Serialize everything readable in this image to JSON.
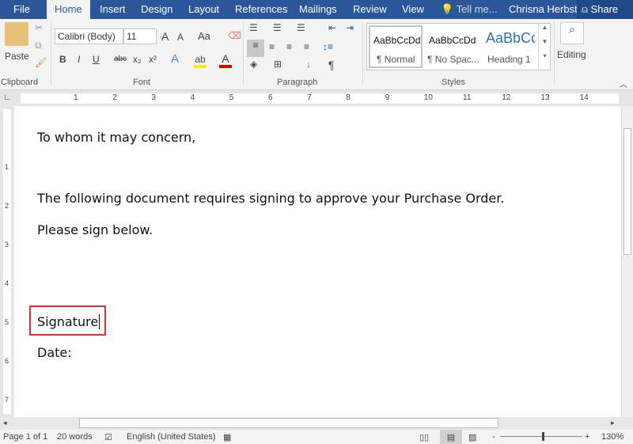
{
  "tabs": [
    {
      "label": "File"
    },
    {
      "label": "Home"
    },
    {
      "label": "Insert"
    },
    {
      "label": "Design"
    },
    {
      "label": "Layout"
    },
    {
      "label": "References"
    },
    {
      "label": "Mailings"
    },
    {
      "label": "Review"
    },
    {
      "label": "View"
    }
  ],
  "tell_me": "Tell me...",
  "user": "Chrisna Herbst",
  "share": "Share",
  "clipboard": {
    "paste": "Paste",
    "label": "Clipboard"
  },
  "font": {
    "name": "Calibri (Body)",
    "size": "11",
    "grow": "A",
    "shrink": "A",
    "case": "Aa",
    "bold": "B",
    "italic": "I",
    "underline": "U",
    "strike": "abc",
    "sub": "x₂",
    "sup": "x²",
    "effects": "A",
    "color": "A",
    "label": "Font"
  },
  "paragraph": {
    "label": "Paragraph",
    "pilcrow": "¶"
  },
  "styles": {
    "label": "Styles",
    "items": [
      {
        "preview": "AaBbCcDd",
        "name": "¶ Normal"
      },
      {
        "preview": "AaBbCcDd",
        "name": "¶ No Spac..."
      },
      {
        "preview": "AaBbCc",
        "name": "Heading 1"
      }
    ]
  },
  "editing": {
    "label": "Editing"
  },
  "ruler": [
    "1",
    "2",
    "3",
    "4",
    "5",
    "6",
    "7",
    "8",
    "9",
    "10",
    "11",
    "12",
    "13",
    "14"
  ],
  "vruler": [
    "1",
    "2",
    "3",
    "4",
    "5",
    "6",
    "7"
  ],
  "document": {
    "lines": [
      "To whom it may concern,",
      "The following document requires signing to approve your Purchase Order.",
      "Please sign below.",
      "Signature",
      "Date:"
    ]
  },
  "status": {
    "page": "Page 1 of 1",
    "words": "20 words",
    "language": "English (United States)",
    "zoom": "130%",
    "zoom_minus": "-",
    "zoom_plus": "+"
  },
  "colors": {
    "accent": "#2b579a",
    "highlight": "#e03030"
  }
}
